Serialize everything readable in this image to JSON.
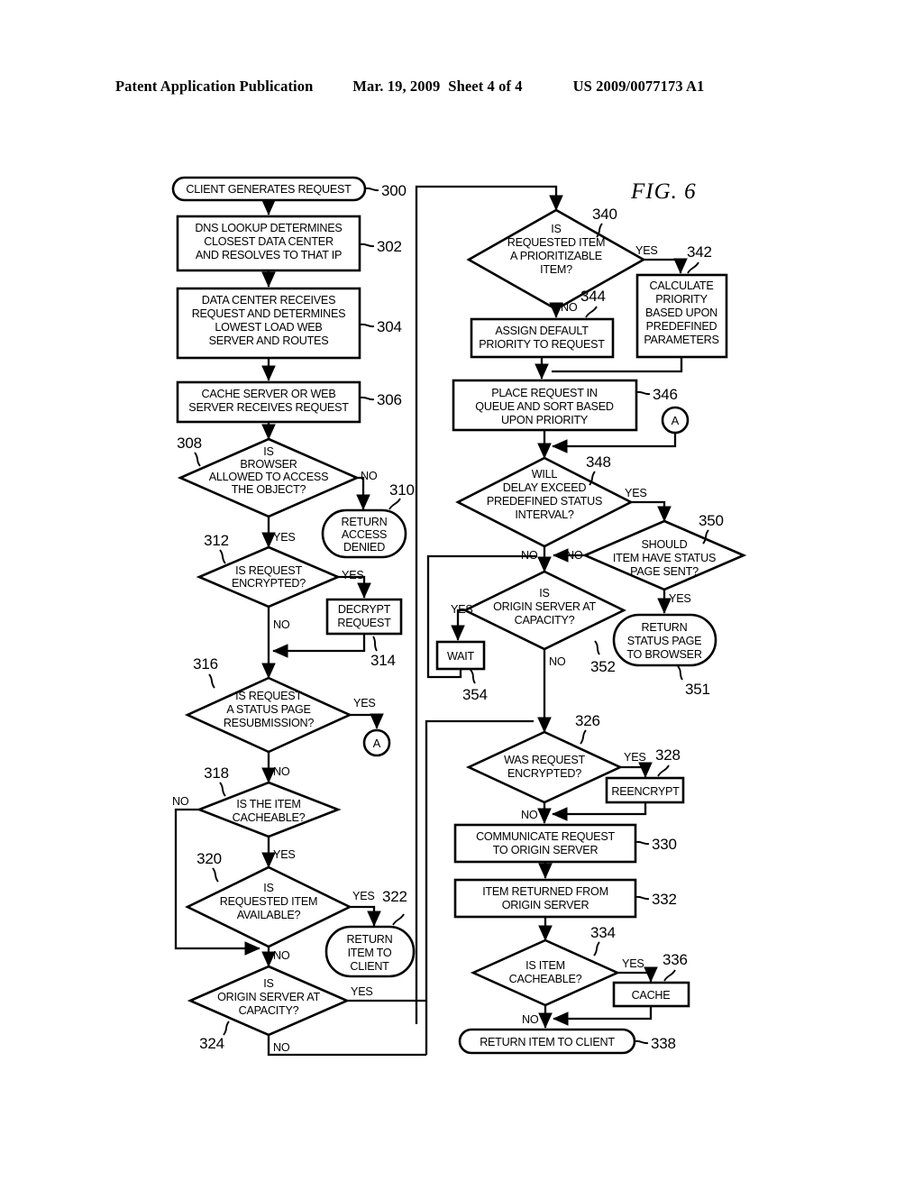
{
  "header": {
    "publication": "Patent Application Publication",
    "date": "Mar. 19, 2009",
    "sheet": "Sheet 4 of 4",
    "patent_number": "US 2009/0077173 A1"
  },
  "figure": {
    "label": "FIG. 6"
  },
  "nodes": {
    "n300": {
      "ref": "300",
      "text": "CLIENT GENERATES REQUEST",
      "type": "terminator"
    },
    "n302": {
      "ref": "302",
      "lines": [
        "DNS LOOKUP DETERMINES",
        "CLOSEST DATA CENTER",
        "AND RESOLVES TO THAT IP"
      ],
      "type": "process"
    },
    "n304": {
      "ref": "304",
      "lines": [
        "DATA CENTER RECEIVES",
        "REQUEST AND DETERMINES",
        "LOWEST LOAD WEB",
        "SERVER AND ROUTES"
      ],
      "type": "process"
    },
    "n306": {
      "ref": "306",
      "lines": [
        "CACHE SERVER OR WEB",
        "SERVER RECEIVES REQUEST"
      ],
      "type": "process"
    },
    "n308": {
      "ref": "308",
      "lines": [
        "IS",
        "BROWSER",
        "ALLOWED TO ACCESS",
        "THE OBJECT?"
      ],
      "type": "decision"
    },
    "n310": {
      "ref": "310",
      "lines": [
        "RETURN",
        "ACCESS",
        "DENIED"
      ],
      "type": "terminator"
    },
    "n312": {
      "ref": "312",
      "lines": [
        "IS REQUEST",
        "ENCRYPTED?"
      ],
      "type": "decision"
    },
    "n314": {
      "ref": "314",
      "lines": [
        "DECRYPT",
        "REQUEST"
      ],
      "type": "process"
    },
    "n316": {
      "ref": "316",
      "lines": [
        "IS REQUEST",
        "A STATUS PAGE",
        "RESUBMISSION?"
      ],
      "type": "decision"
    },
    "n318": {
      "ref": "318",
      "lines": [
        "IS THE ITEM",
        "CACHEABLE?"
      ],
      "type": "decision"
    },
    "n320": {
      "ref": "320",
      "lines": [
        "IS",
        "REQUESTED ITEM",
        "AVAILABLE?"
      ],
      "type": "decision"
    },
    "n322": {
      "ref": "322",
      "lines": [
        "RETURN",
        "ITEM TO",
        "CLIENT"
      ],
      "type": "terminator"
    },
    "n324": {
      "ref": "324",
      "lines": [
        "IS",
        "ORIGIN SERVER AT",
        "CAPACITY?"
      ],
      "type": "decision"
    },
    "n326": {
      "ref": "326",
      "lines": [
        "WAS REQUEST",
        "ENCRYPTED?"
      ],
      "type": "decision"
    },
    "n328": {
      "ref": "328",
      "lines": [
        "REENCRYPT"
      ],
      "type": "process"
    },
    "n330": {
      "ref": "330",
      "lines": [
        "COMMUNICATE REQUEST",
        "TO ORIGIN SERVER"
      ],
      "type": "process"
    },
    "n332": {
      "ref": "332",
      "lines": [
        "ITEM RETURNED FROM",
        "ORIGIN SERVER"
      ],
      "type": "process"
    },
    "n334": {
      "ref": "334",
      "lines": [
        "IS ITEM",
        "CACHEABLE?"
      ],
      "type": "decision"
    },
    "n336": {
      "ref": "336",
      "lines": [
        "CACHE"
      ],
      "type": "process"
    },
    "n338": {
      "ref": "338",
      "text": "RETURN ITEM TO CLIENT",
      "type": "terminator"
    },
    "n340": {
      "ref": "340",
      "lines": [
        "IS",
        "REQUESTED ITEM",
        "A PRIORITIZABLE",
        "ITEM?"
      ],
      "type": "decision"
    },
    "n342": {
      "ref": "342",
      "lines": [
        "CALCULATE",
        "PRIORITY",
        "BASED UPON",
        "PREDEFINED",
        "PARAMETERS"
      ],
      "type": "process"
    },
    "n344": {
      "ref": "344",
      "lines": [
        "ASSIGN DEFAULT",
        "PRIORITY TO REQUEST"
      ],
      "type": "process"
    },
    "n346": {
      "ref": "346",
      "lines": [
        "PLACE REQUEST IN",
        "QUEUE AND SORT BASED",
        "UPON PRIORITY"
      ],
      "type": "process"
    },
    "n348": {
      "ref": "348",
      "lines": [
        "WILL",
        "DELAY EXCEED",
        "PREDEFINED STATUS",
        "INTERVAL?"
      ],
      "type": "decision"
    },
    "n350": {
      "ref": "350",
      "lines": [
        "SHOULD",
        "ITEM HAVE STATUS",
        "PAGE SENT?"
      ],
      "type": "decision"
    },
    "n351": {
      "ref": "351",
      "lines": [
        "RETURN",
        "STATUS PAGE",
        "TO BROWSER"
      ],
      "type": "terminator"
    },
    "n352": {
      "ref": "352",
      "lines": [
        "IS",
        "ORIGIN SERVER AT",
        "CAPACITY?"
      ],
      "type": "decision"
    },
    "n354": {
      "ref": "354",
      "lines": [
        "WAIT"
      ],
      "type": "process"
    }
  },
  "connectors": {
    "a_left": "A",
    "a_right": "A"
  },
  "edge_labels": {
    "e308_no": "NO",
    "e308_yes": "YES",
    "e312_yes": "YES",
    "e312_no": "NO",
    "e316_yes": "YES",
    "e316_no": "NO",
    "e318_no": "NO",
    "e318_yes": "YES",
    "e320_yes": "YES",
    "e320_no": "NO",
    "e324_yes": "YES",
    "e324_no": "NO",
    "e326_yes": "YES",
    "e326_no": "NO",
    "e334_yes": "YES",
    "e334_no": "NO",
    "e340_yes": "YES",
    "e340_no": "NO",
    "e348_yes": "YES",
    "e348_no": "NO",
    "e350_no": "NO",
    "e350_yes": "YES",
    "e352_yes": "YES",
    "e352_no": "NO"
  }
}
